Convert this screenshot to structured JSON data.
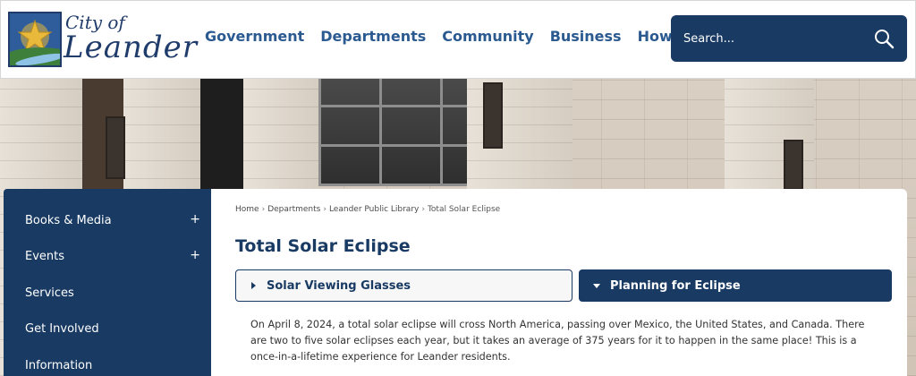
{
  "header": {
    "logo": {
      "city_text": "City of",
      "name_text": "Leander"
    },
    "nav": [
      {
        "label": "Government"
      },
      {
        "label": "Departments"
      },
      {
        "label": "Community"
      },
      {
        "label": "Business"
      },
      {
        "label": "How Do I..."
      }
    ],
    "search": {
      "placeholder": "Search...",
      "icon": "search-icon"
    }
  },
  "sidebar": {
    "items": [
      {
        "label": "Books & Media",
        "expand": "+"
      },
      {
        "label": "Events",
        "expand": "+"
      },
      {
        "label": "Services",
        "expand": ""
      },
      {
        "label": "Get Involved",
        "expand": ""
      },
      {
        "label": "Information",
        "expand": ""
      }
    ]
  },
  "breadcrumb": [
    {
      "label": "Home"
    },
    {
      "label": "Departments"
    },
    {
      "label": "Leander Public Library"
    },
    {
      "label": "Total Solar Eclipse"
    }
  ],
  "page": {
    "title": "Total Solar Eclipse",
    "accordion": [
      {
        "label": "Solar Viewing Glasses",
        "expanded": false
      },
      {
        "label": "Planning for Eclipse",
        "expanded": true
      }
    ],
    "body": "On April 8, 2024, a total solar eclipse will cross North America, passing over Mexico, the United States, and Canada. There are two to five solar eclipses each year, but it takes an average of 375 years for it to happen in the same place! This is a once-in-a-lifetime experience for Leander residents."
  },
  "colors": {
    "brand_navy": "#183a63",
    "nav_blue": "#2b5a91",
    "logo_gold": "#e2b43a",
    "logo_green": "#3f7f3c"
  }
}
